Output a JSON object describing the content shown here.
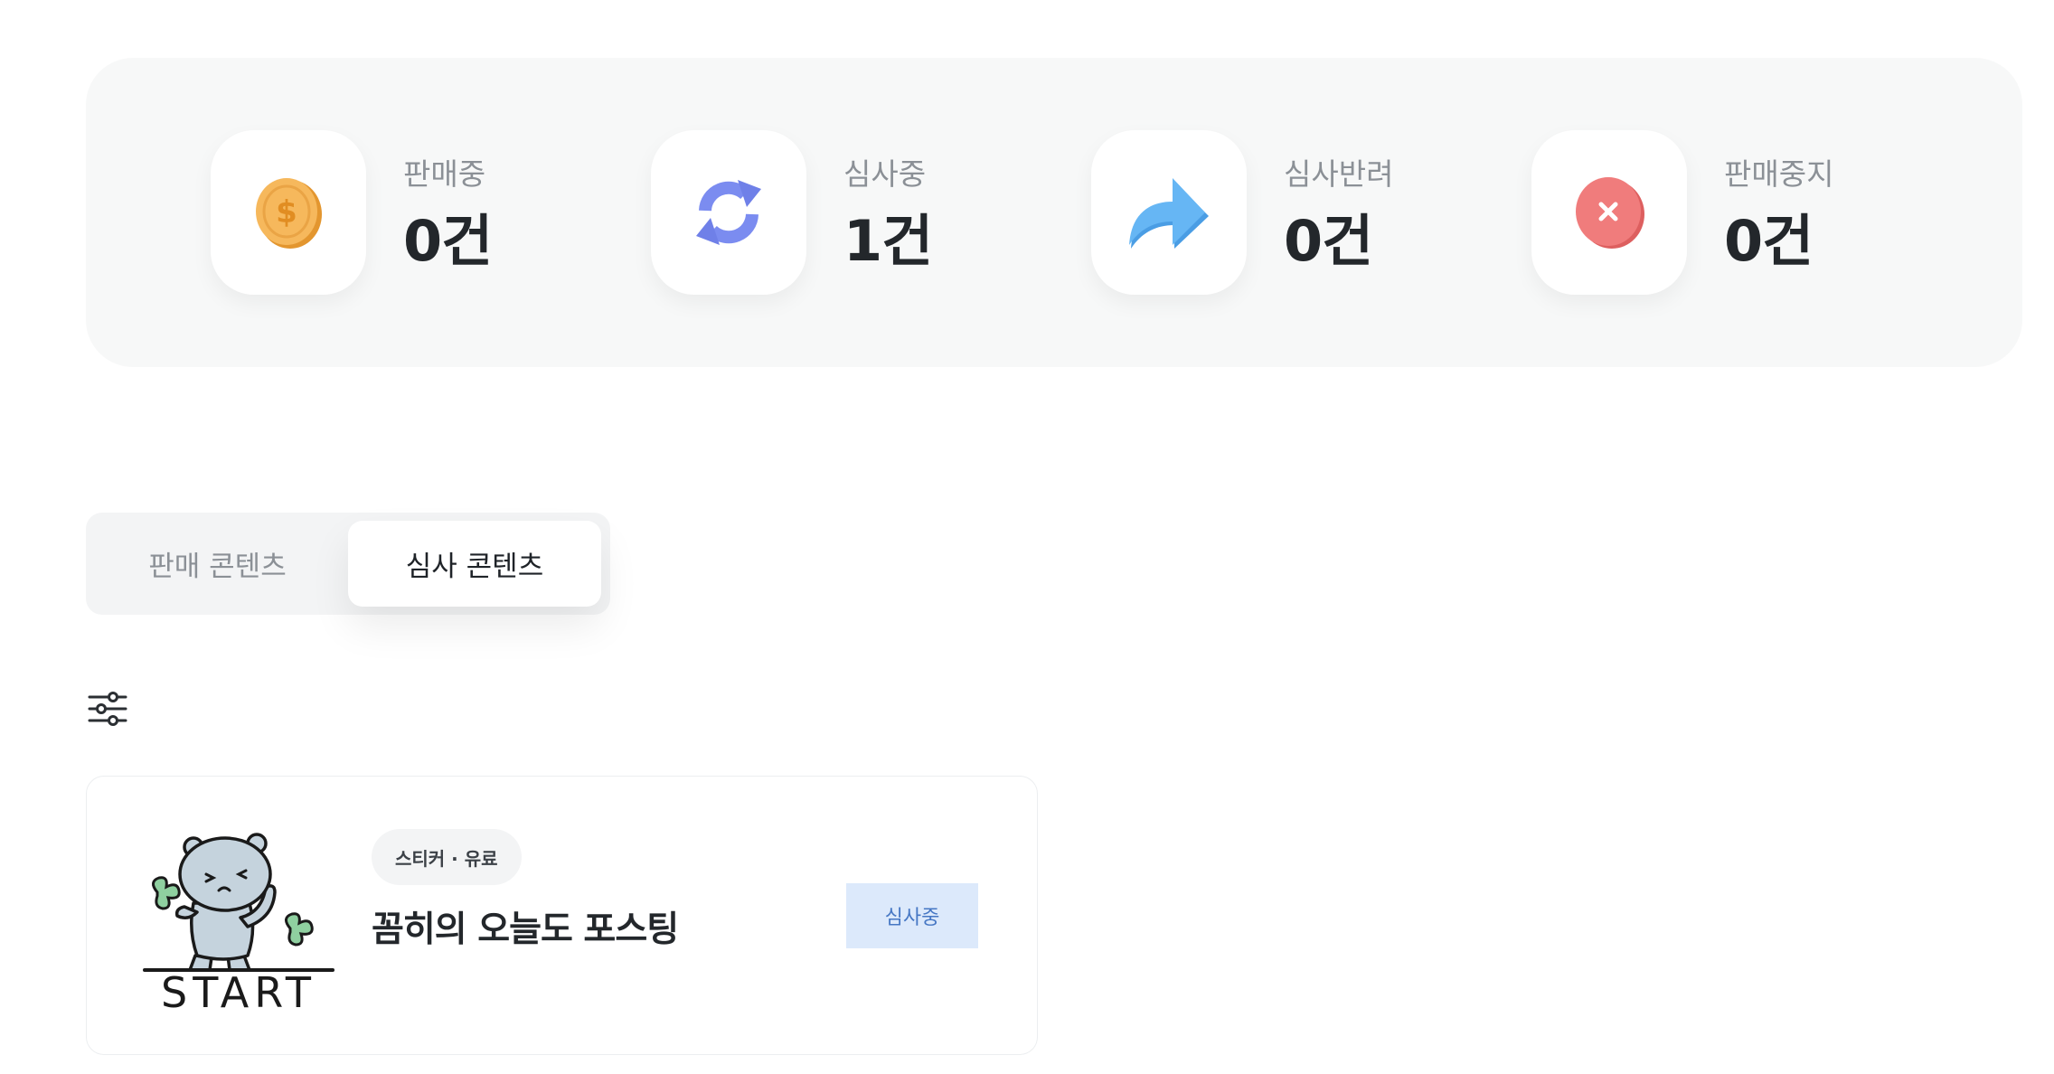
{
  "stats": [
    {
      "label": "판매중",
      "value": "0건",
      "icon": "coin-icon"
    },
    {
      "label": "심사중",
      "value": "1건",
      "icon": "refresh-icon"
    },
    {
      "label": "심사반려",
      "value": "0건",
      "icon": "arrow-forward-icon"
    },
    {
      "label": "판매중지",
      "value": "0건",
      "icon": "x-circle-icon"
    }
  ],
  "tabs": [
    {
      "label": "판매 콘텐츠",
      "active": false
    },
    {
      "label": "심사 콘텐츠",
      "active": true
    }
  ],
  "filter": {
    "icon": "sliders-icon"
  },
  "items": [
    {
      "thumbnail_text": "START",
      "tag": "스티커 · 유료",
      "title": "꼼히의 오늘도 포스팅",
      "status": "심사중"
    }
  ],
  "colors": {
    "panel_bg": "#f7f8f8",
    "status_bg": "#dce9fb",
    "status_text": "#4677c4",
    "coin": "#f4b25a",
    "refresh": "#7b8cf0",
    "arrow": "#5aaef0",
    "stop": "#f07a7a"
  }
}
